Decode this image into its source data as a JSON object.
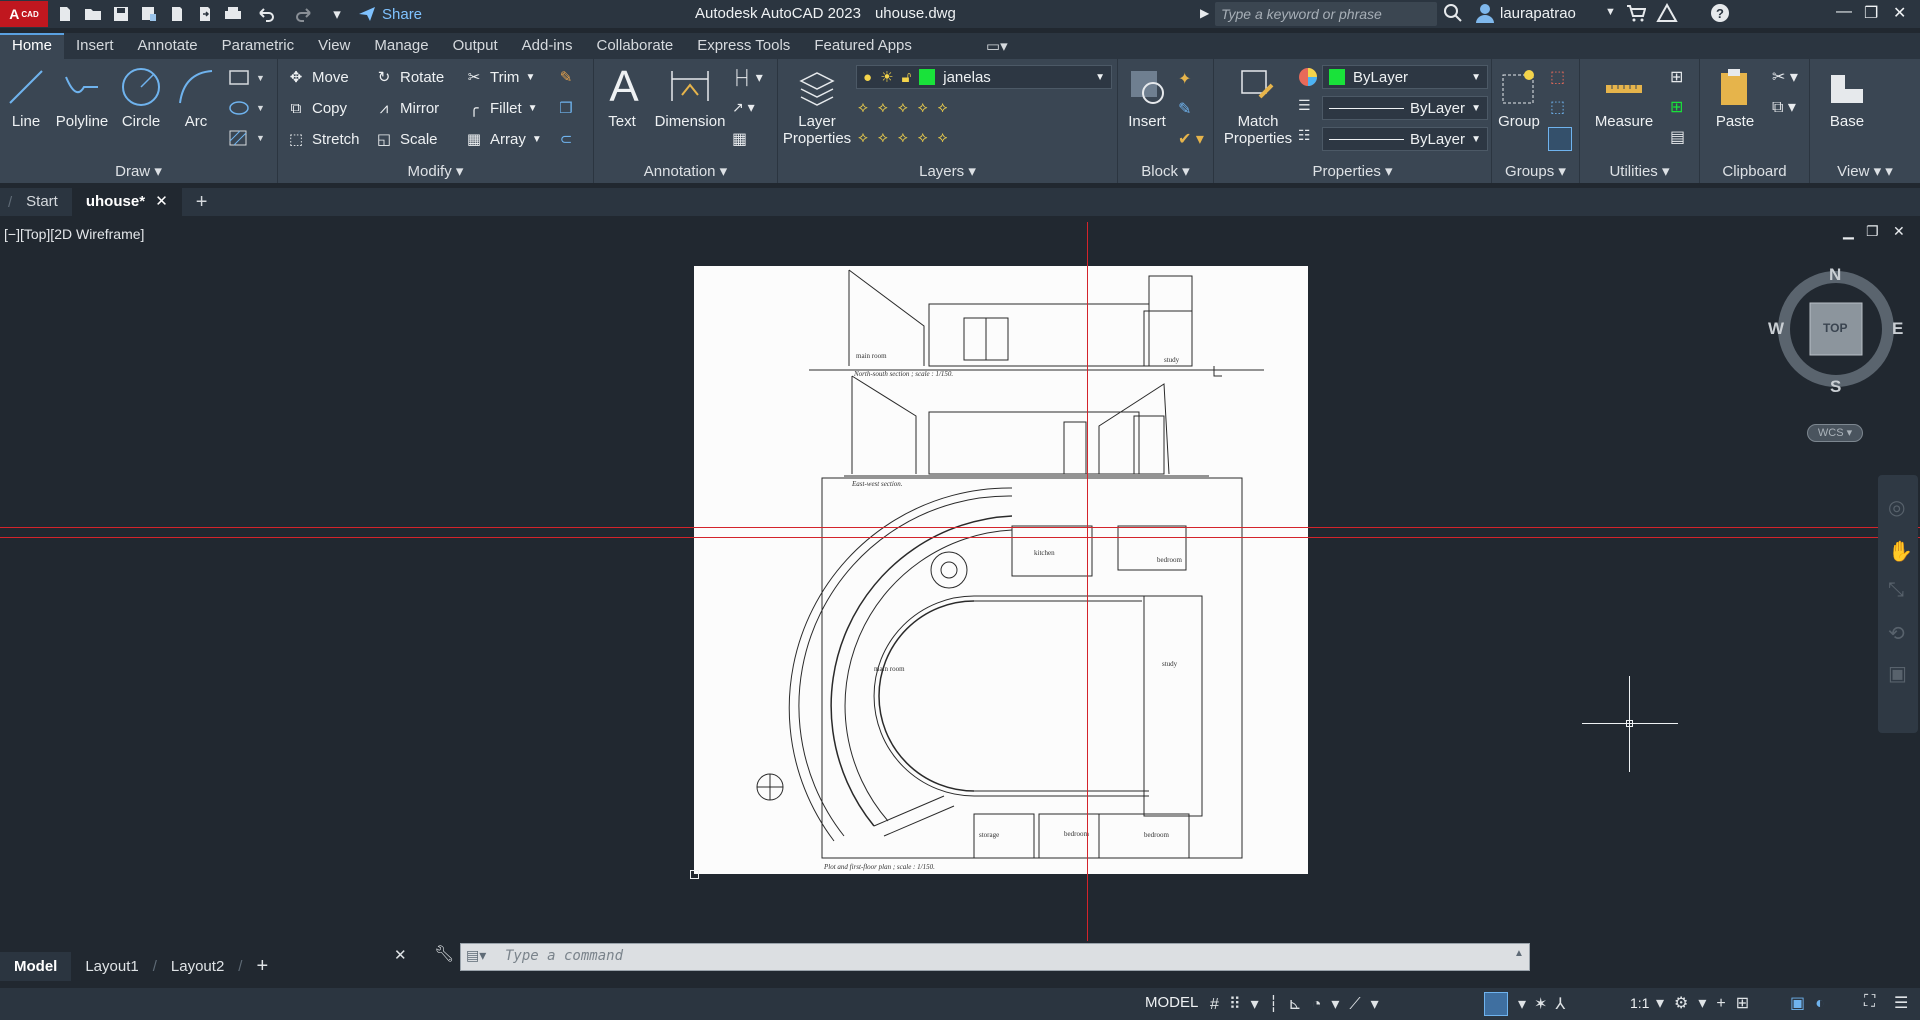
{
  "titlebar": {
    "logo": "A",
    "logo_suffix": "CAD",
    "share_label": "Share",
    "app_name": "Autodesk AutoCAD 2023",
    "file_name": "uhouse.dwg",
    "search_placeholder": "Type a keyword or phrase",
    "user": "laurapatrao"
  },
  "ribbon_tabs": [
    "Home",
    "Insert",
    "Annotate",
    "Parametric",
    "View",
    "Manage",
    "Output",
    "Add-ins",
    "Collaborate",
    "Express Tools",
    "Featured Apps"
  ],
  "ribbon": {
    "draw": {
      "title": "Draw",
      "line": "Line",
      "polyline": "Polyline",
      "circle": "Circle",
      "arc": "Arc"
    },
    "modify": {
      "title": "Modify",
      "move": "Move",
      "rotate": "Rotate",
      "trim": "Trim",
      "copy": "Copy",
      "mirror": "Mirror",
      "fillet": "Fillet",
      "stretch": "Stretch",
      "scale": "Scale",
      "array": "Array"
    },
    "annotation": {
      "title": "Annotation",
      "text": "Text",
      "dimension": "Dimension"
    },
    "layers": {
      "title": "Layers",
      "layer_properties_1": "Layer",
      "layer_properties_2": "Properties",
      "current_layer": "janelas"
    },
    "block": {
      "title": "Block",
      "insert": "Insert"
    },
    "properties": {
      "title": "Properties",
      "match_1": "Match",
      "match_2": "Properties",
      "color": "ByLayer",
      "linetype": "ByLayer",
      "lineweight": "ByLayer"
    },
    "groups": {
      "title": "Groups",
      "group": "Group"
    },
    "utilities": {
      "title": "Utilities",
      "measure": "Measure"
    },
    "clipboard": {
      "title": "Clipboard",
      "paste": "Paste"
    },
    "view": {
      "title": "View",
      "base": "Base"
    }
  },
  "file_tabs": {
    "start": "Start",
    "current": "uhouse*"
  },
  "viewport": {
    "label": "[−][Top][2D Wireframe]",
    "drawing_labels": {
      "ns_section": "North-south section ; scale : 1/150.",
      "ew_section": "East-west section.",
      "plan": "Plot and first-floor plan ; scale : 1/150.",
      "main_room": "main room",
      "study": "study",
      "kitchen": "kitchen",
      "bedroom": "bedroom",
      "storage": "storage"
    }
  },
  "viewcube": {
    "n": "N",
    "s": "S",
    "e": "E",
    "w": "W",
    "face": "TOP",
    "wcs": "WCS"
  },
  "layout_tabs": [
    "Model",
    "Layout1",
    "Layout2"
  ],
  "command": {
    "placeholder": "Type a command"
  },
  "status": {
    "model": "MODEL",
    "scale": "1:1"
  },
  "colors": {
    "accent": "#5aa1e1",
    "crosshair": "#d4242b",
    "layer_green": "#19e23a"
  }
}
